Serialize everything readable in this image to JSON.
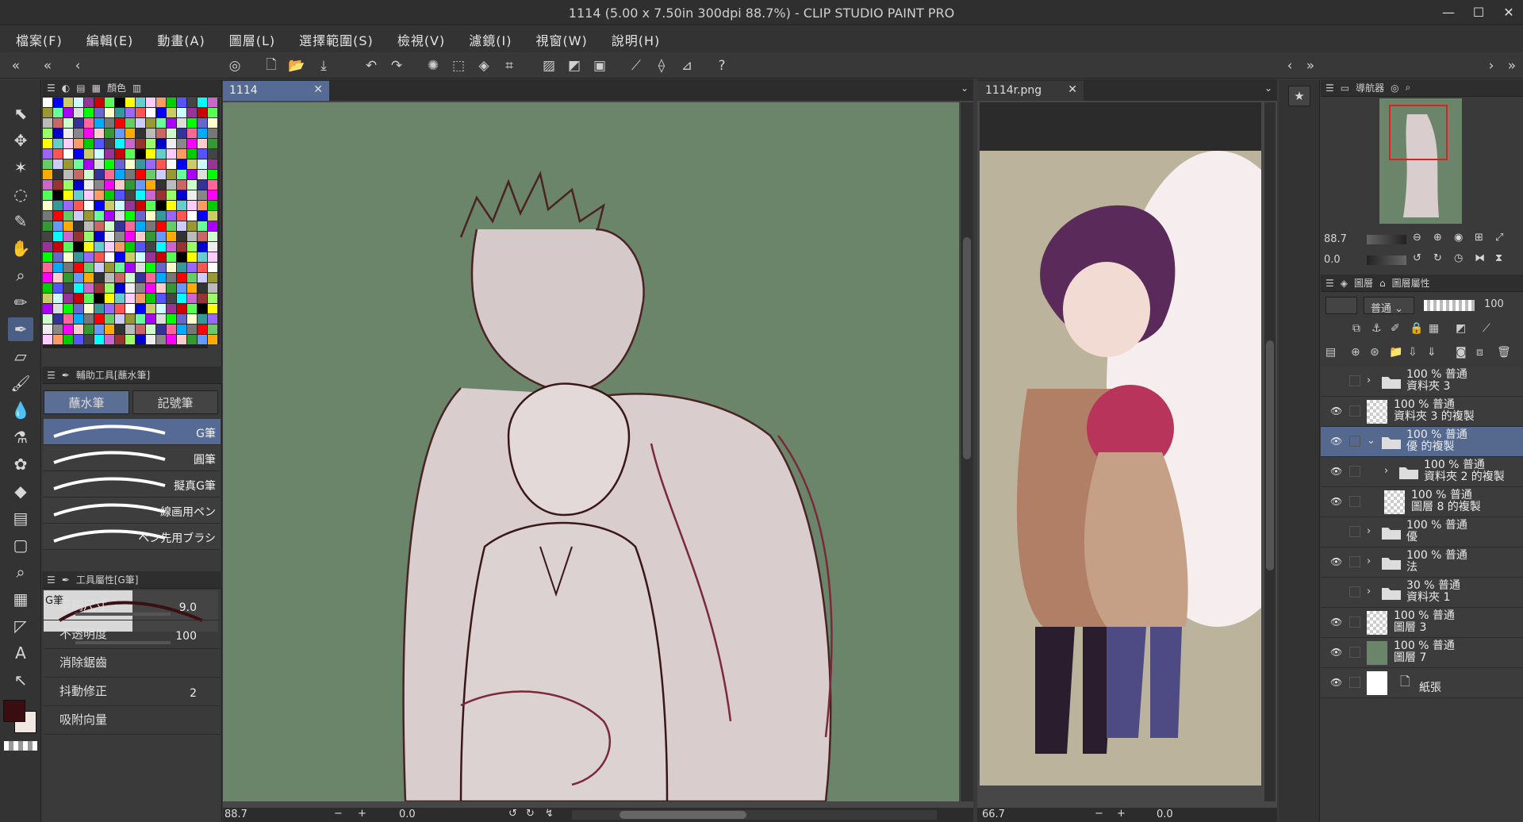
{
  "window": {
    "title": "1114 (5.00 x 7.50in 300dpi 88.7%)  - CLIP STUDIO PAINT PRO"
  },
  "menu": [
    "檔案(F)",
    "編輯(E)",
    "動畫(A)",
    "圖層(L)",
    "選擇範圍(S)",
    "檢視(V)",
    "濾鏡(I)",
    "視窗(W)",
    "說明(H)"
  ],
  "panels": {
    "color_tab": "顏色",
    "subtool_header": "輔助工具[蘸水筆]",
    "subtool_tabs": [
      "蘸水筆",
      "記號筆"
    ],
    "brushes": [
      "G筆",
      "圓筆",
      "擬真G筆",
      "線画用ペン",
      "ペン先用ブラシ"
    ],
    "toolprop_header": "工具屬性[G筆]",
    "toolprop_preview": "G筆",
    "props": [
      {
        "label": "筆刷尺寸",
        "value": "9.0"
      },
      {
        "label": "不透明度",
        "value": "100"
      },
      {
        "label": "消除鋸齒",
        "value": ""
      },
      {
        "label": "抖動修正",
        "value": "2"
      },
      {
        "label": "吸附向量",
        "value": ""
      }
    ]
  },
  "canvas": {
    "tab": "1114",
    "zoom": "88.7",
    "angle": "0.0"
  },
  "reference": {
    "tab": "1114r.png",
    "zoom": "66.7",
    "angle": "0.0"
  },
  "navigator": {
    "label": "導航器",
    "zoom": "88.7",
    "angle": "0.0"
  },
  "layers_panel": {
    "label": "圖層",
    "label2": "圖層屬性",
    "blend": "普通",
    "opacity": "100"
  },
  "layers": [
    {
      "line1": "100 % 普通",
      "line2": "資料夾 3",
      "type": "folder",
      "indent": 0,
      "eye": false
    },
    {
      "line1": "100 % 普通",
      "line2": "資料夾 3 的複製",
      "type": "layer",
      "indent": 0,
      "eye": true
    },
    {
      "line1": "100 % 普通",
      "line2": "優 的複製",
      "type": "folder",
      "indent": 0,
      "eye": true,
      "selected": true
    },
    {
      "line1": "100 % 普通",
      "line2": "資料夾 2 的複製",
      "type": "folder",
      "indent": 1,
      "eye": true
    },
    {
      "line1": "100 % 普通",
      "line2": "圖層 8 的複製",
      "type": "layer",
      "indent": 1,
      "eye": true
    },
    {
      "line1": "100 % 普通",
      "line2": "優",
      "type": "folder",
      "indent": 0,
      "eye": false
    },
    {
      "line1": "100 % 普通",
      "line2": "法",
      "type": "folder",
      "indent": 0,
      "eye": true
    },
    {
      "line1": "30 % 普通",
      "line2": "資料夾 1",
      "type": "folder",
      "indent": 0,
      "eye": false
    },
    {
      "line1": "100 % 普通",
      "line2": "圖層 3",
      "type": "layer",
      "indent": 0,
      "eye": true
    },
    {
      "line1": "100 % 普通",
      "line2": "圖層 7",
      "type": "green",
      "indent": 0,
      "eye": true
    },
    {
      "line1": "",
      "line2": "紙張",
      "type": "paper",
      "indent": 0,
      "eye": true
    }
  ],
  "colors": {
    "accent": "#566b93",
    "canvas_bg": "#6a8569",
    "main_color": "#3a0e10",
    "sub_color": "#f2e6e2"
  }
}
